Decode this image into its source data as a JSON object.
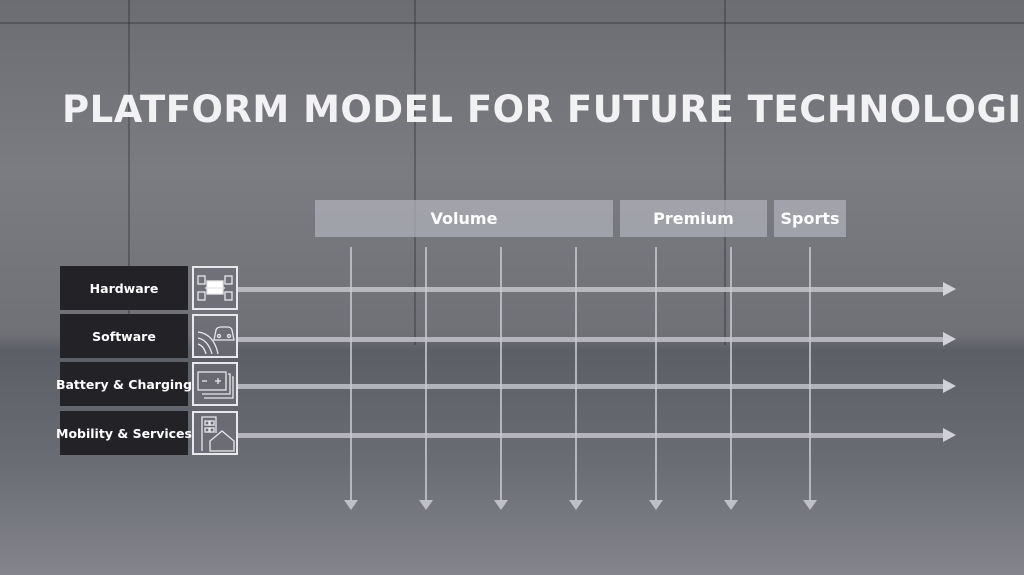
{
  "title": "PLATFORM MODEL FOR FUTURE TECHNOLOGIES",
  "segments": [
    "Volume",
    "Premium",
    "Sports"
  ],
  "rows": [
    {
      "label": "Hardware",
      "icon": "chassis-icon"
    },
    {
      "label": "Software",
      "icon": "connected-car-icon"
    },
    {
      "label": "Battery & Charging",
      "icon": "battery-icon"
    },
    {
      "label": "Mobility & Services",
      "icon": "building-house-icon"
    }
  ]
}
